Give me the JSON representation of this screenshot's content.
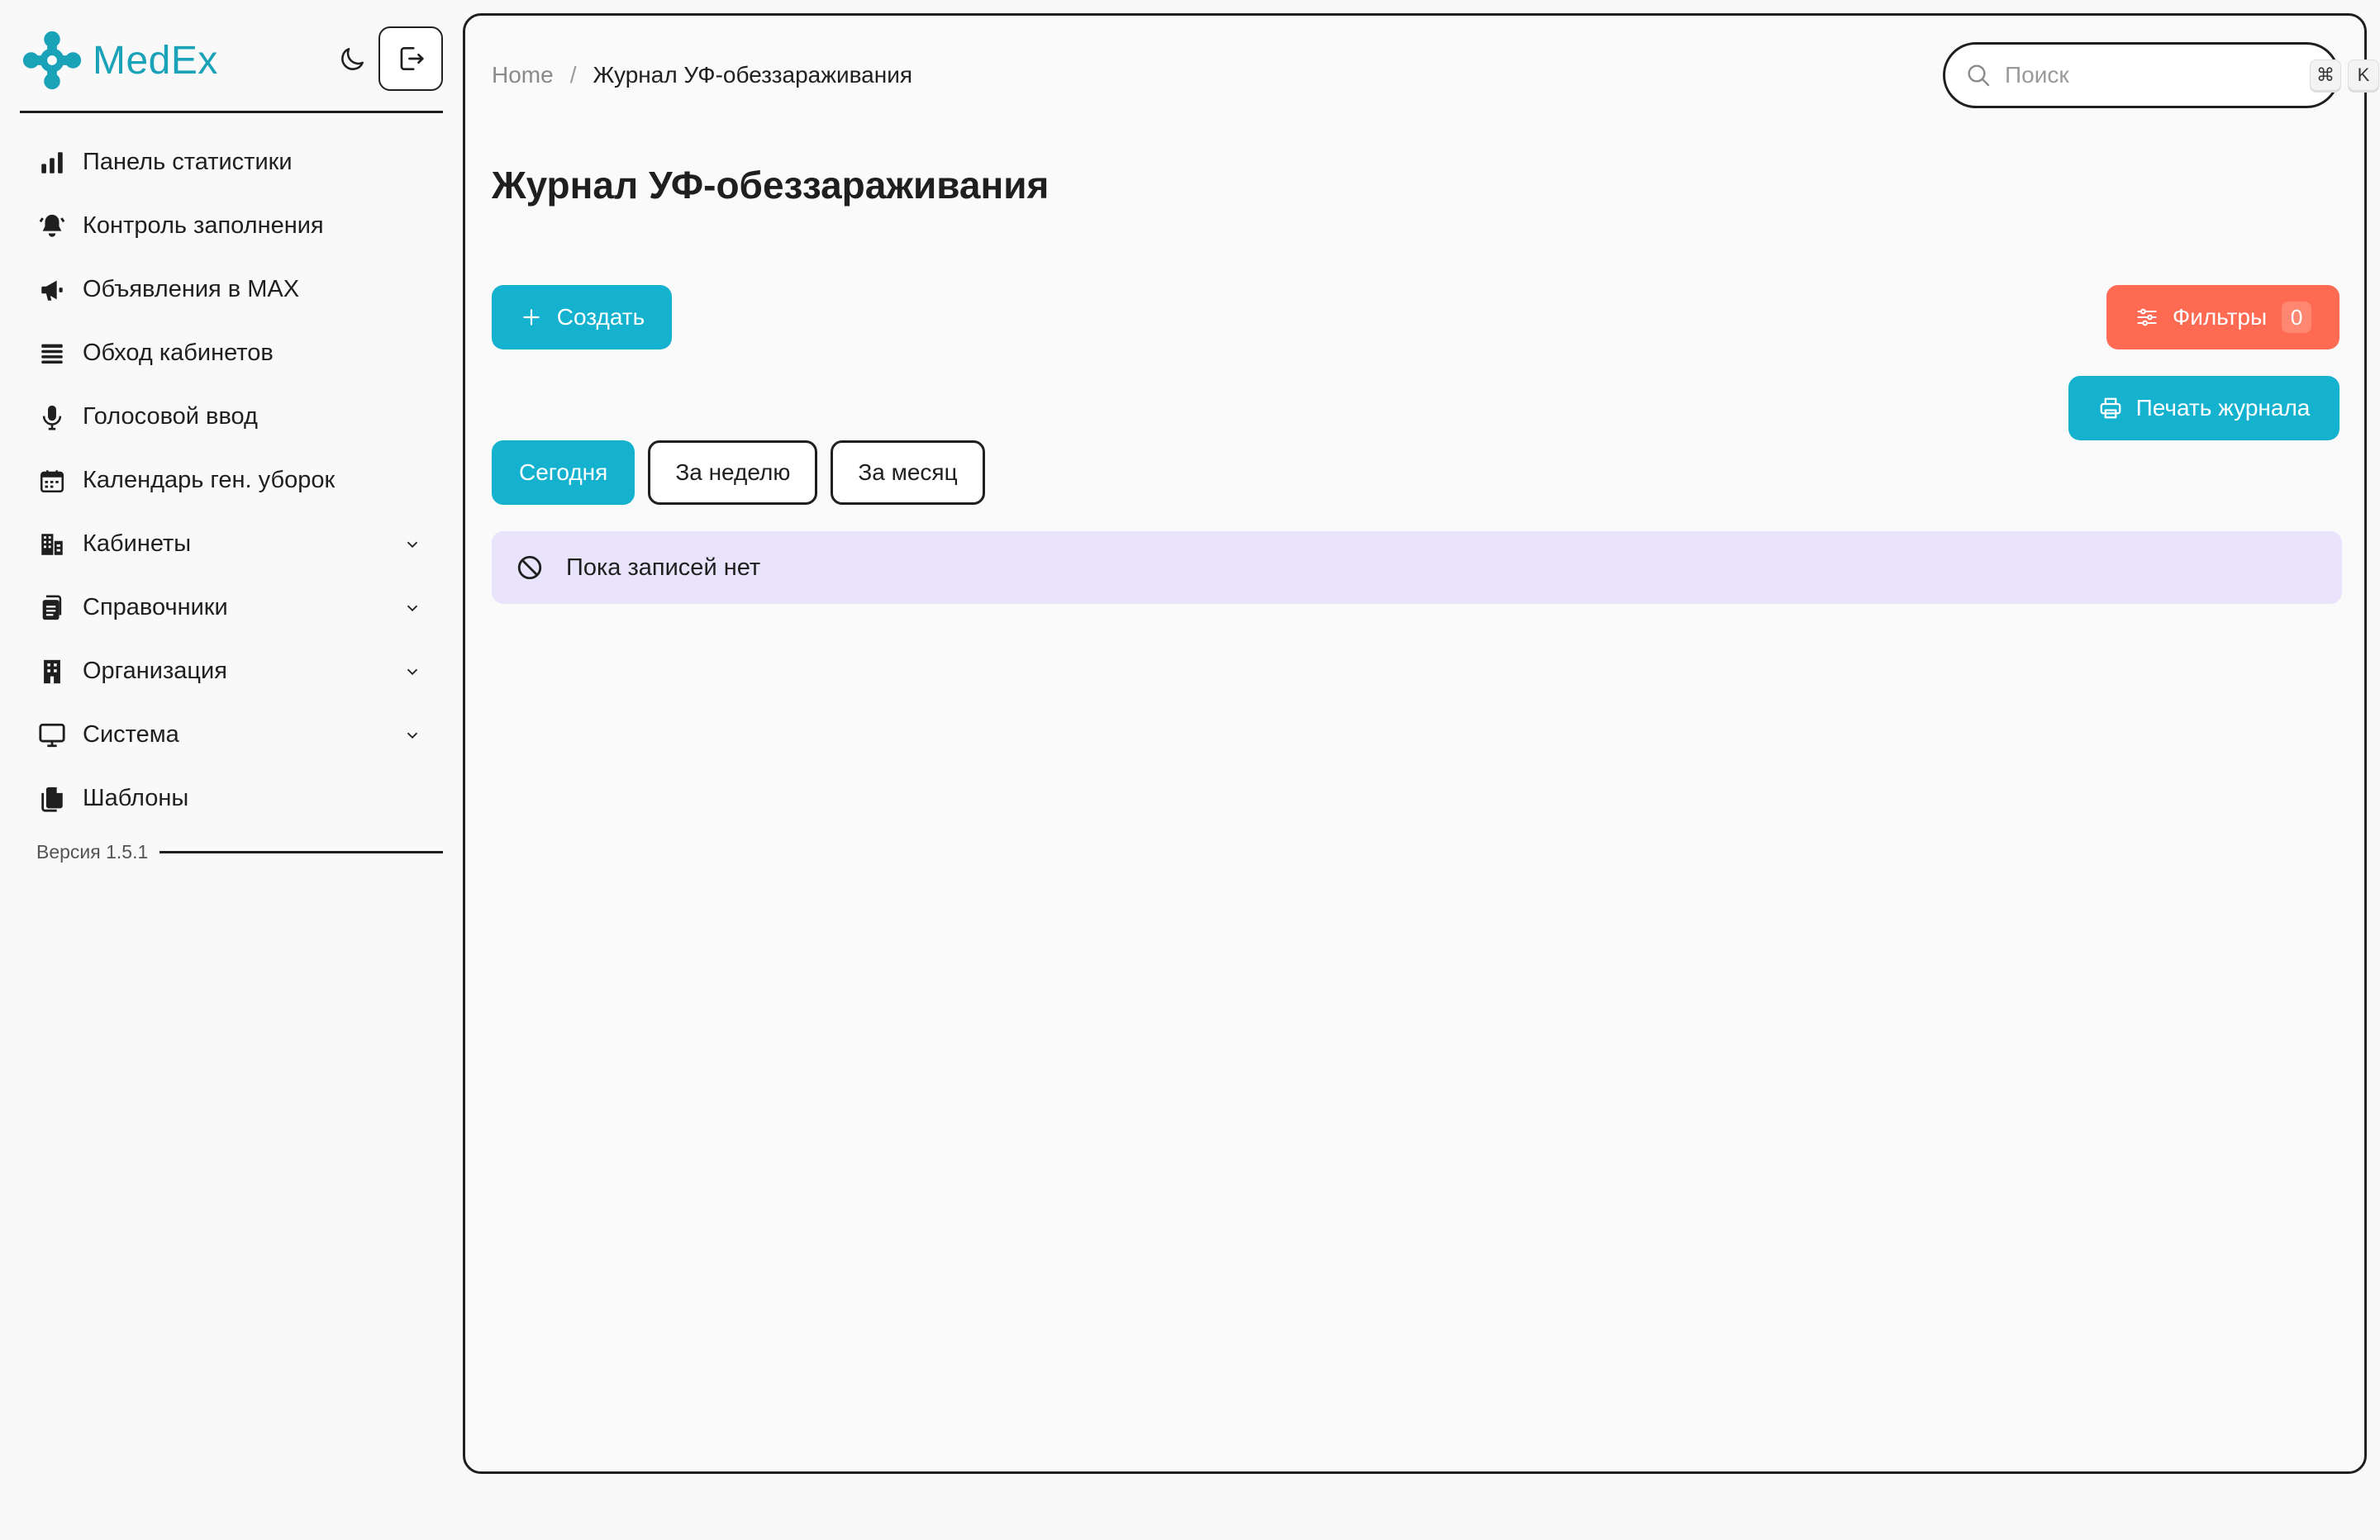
{
  "brand": {
    "name": "MedEx",
    "accent": "#1aa3b8"
  },
  "sidebar": {
    "items": [
      {
        "label": "Панель статистики",
        "icon": "bar-chart-icon",
        "has_children": false
      },
      {
        "label": "Контроль заполнения",
        "icon": "bell-icon",
        "has_children": false
      },
      {
        "label": "Объявления в MAX",
        "icon": "megaphone-icon",
        "has_children": false
      },
      {
        "label": "Обход кабинетов",
        "icon": "list-icon",
        "has_children": false
      },
      {
        "label": "Голосовой ввод",
        "icon": "microphone-icon",
        "has_children": false
      },
      {
        "label": "Календарь ген. уборок",
        "icon": "calendar-icon",
        "has_children": false
      },
      {
        "label": "Кабинеты",
        "icon": "building-icon",
        "has_children": true
      },
      {
        "label": "Справочники",
        "icon": "clipboard-icon",
        "has_children": true
      },
      {
        "label": "Организация",
        "icon": "office-icon",
        "has_children": true
      },
      {
        "label": "Система",
        "icon": "monitor-icon",
        "has_children": true
      },
      {
        "label": "Шаблоны",
        "icon": "copy-icon",
        "has_children": false
      }
    ],
    "version": "Версия 1.5.1"
  },
  "breadcrumb": {
    "home": "Home",
    "separator": "/",
    "current": "Журнал УФ-обеззараживания"
  },
  "search": {
    "placeholder": "Поиск",
    "shortcut_mod": "⌘",
    "shortcut_key": "K"
  },
  "page": {
    "title": "Журнал УФ-обеззараживания"
  },
  "actions": {
    "create": "Создать",
    "filters": "Фильтры",
    "filters_count": "0",
    "print": "Печать журнала"
  },
  "tabs": [
    {
      "label": "Сегодня",
      "active": true
    },
    {
      "label": "За неделю",
      "active": false
    },
    {
      "label": "За месяц",
      "active": false
    }
  ],
  "empty_state": {
    "text": "Пока записей нет"
  },
  "colors": {
    "primary": "#15b2cf",
    "danger": "#ff6a52",
    "info_bg": "#e9e4fb"
  }
}
